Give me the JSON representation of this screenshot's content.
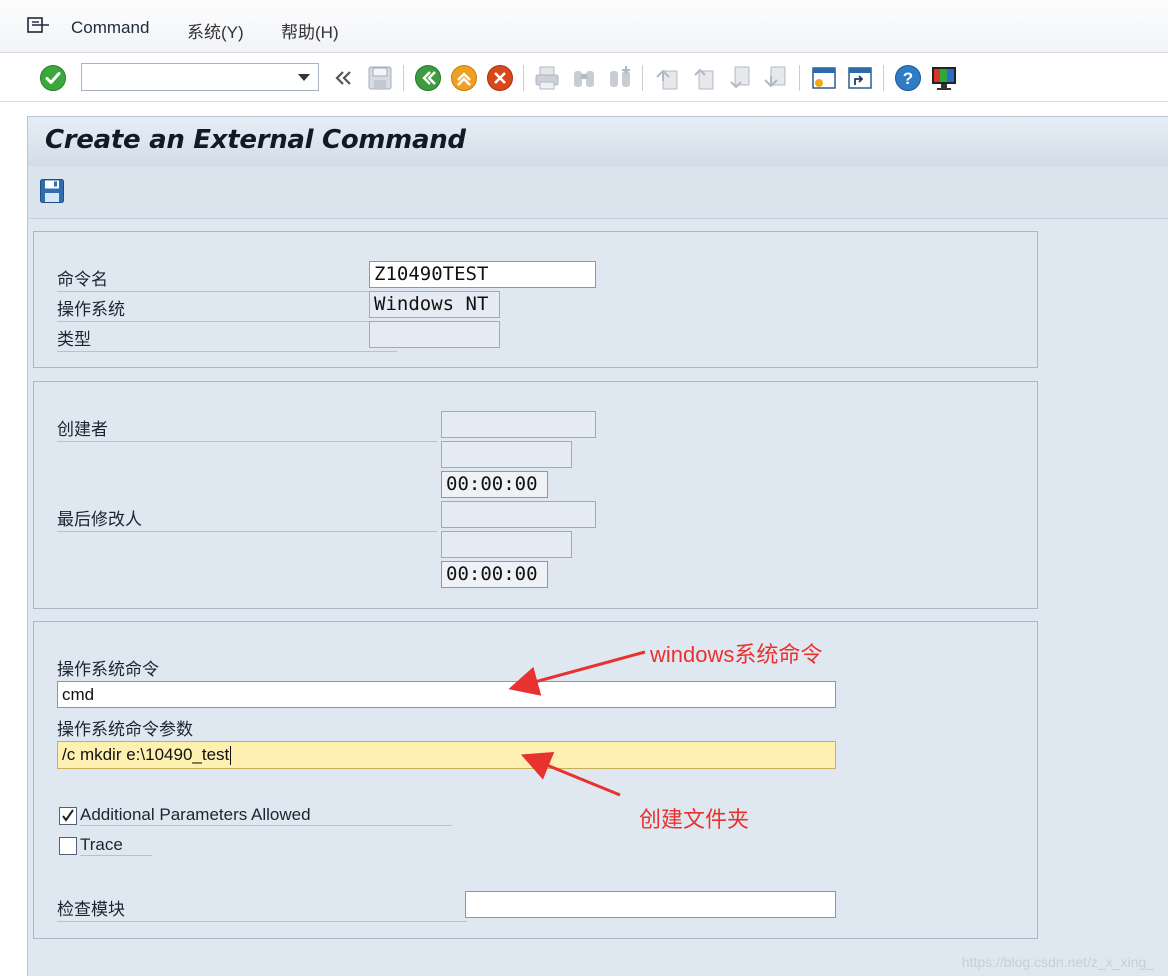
{
  "menubar": {
    "items": [
      {
        "label": "Command"
      },
      {
        "label": "系统(Y)"
      },
      {
        "label": "帮助(H)"
      }
    ]
  },
  "toolbar": {
    "command_value": ""
  },
  "page": {
    "title": "Create an External Command"
  },
  "header_group": {
    "command_name_label": "命令名",
    "command_name_value": "Z10490TEST",
    "os_label": "操作系统",
    "os_value": "Windows NT",
    "type_label": "类型",
    "type_value": ""
  },
  "admin_group": {
    "created_by_label": "创建者",
    "created_by_value": "",
    "created_date_value": "",
    "created_time_value": "00:00:00",
    "changed_by_label": "最后修改人",
    "changed_by_value": "",
    "changed_date_value": "",
    "changed_time_value": "00:00:00"
  },
  "command_group": {
    "os_command_label": "操作系统命令",
    "os_command_value": "cmd",
    "params_label": "操作系统命令参数",
    "params_value": "/c mkdir e:\\10490_test",
    "additional_params_label": "Additional Parameters Allowed",
    "additional_params_checked": true,
    "trace_label": "Trace",
    "trace_checked": false,
    "check_module_label": "检查模块",
    "check_module_value": ""
  },
  "annotations": {
    "windows_command": "windows系统命令",
    "create_folder": "创建文件夹"
  },
  "watermark": "https://blog.csdn.net/z_x_xing_",
  "colors": {
    "accent_red": "#e8322f",
    "panel_bg": "#dfe8f1",
    "active_field": "#fdf0b0"
  }
}
